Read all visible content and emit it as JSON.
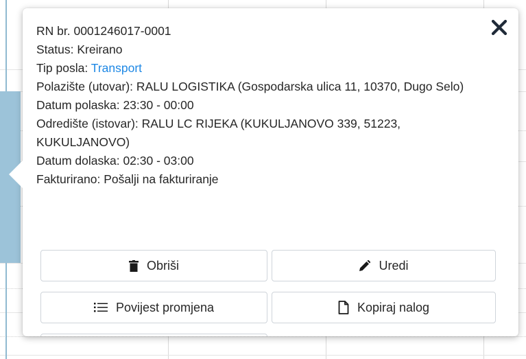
{
  "order": {
    "number_line": "RN br. 0001246017-0001",
    "status_line": "Status: Kreirano",
    "job_type_label": "Tip posla: ",
    "job_type_value": "Transport",
    "origin_line": "Polazište (utovar): RALU LOGISTIKA (Gospodarska ulica 11, 10370, Dugo Selo)",
    "departure_line": "Datum polaska: 23:30 - 00:00",
    "destination_line": "Odredište (istovar): RALU LC RIJEKA (KUKULJANOVO 339, 51223, KUKULJANOVO)",
    "arrival_line": "Datum dolaska: 02:30 - 03:00",
    "invoiced_line": "Fakturirano: Pošalji na fakturiranje"
  },
  "actions": {
    "delete_label": "Obriši",
    "edit_label": "Uredi",
    "history_label": "Povijest promjena",
    "copy_label": "Kopiraj nalog"
  },
  "icons": {
    "close": "close-icon",
    "delete": "trash-icon",
    "edit": "pencil-icon",
    "history": "list-icon",
    "copy": "document-icon"
  },
  "colors": {
    "link": "#1e88e5",
    "event_block": "#9cc3d9"
  }
}
